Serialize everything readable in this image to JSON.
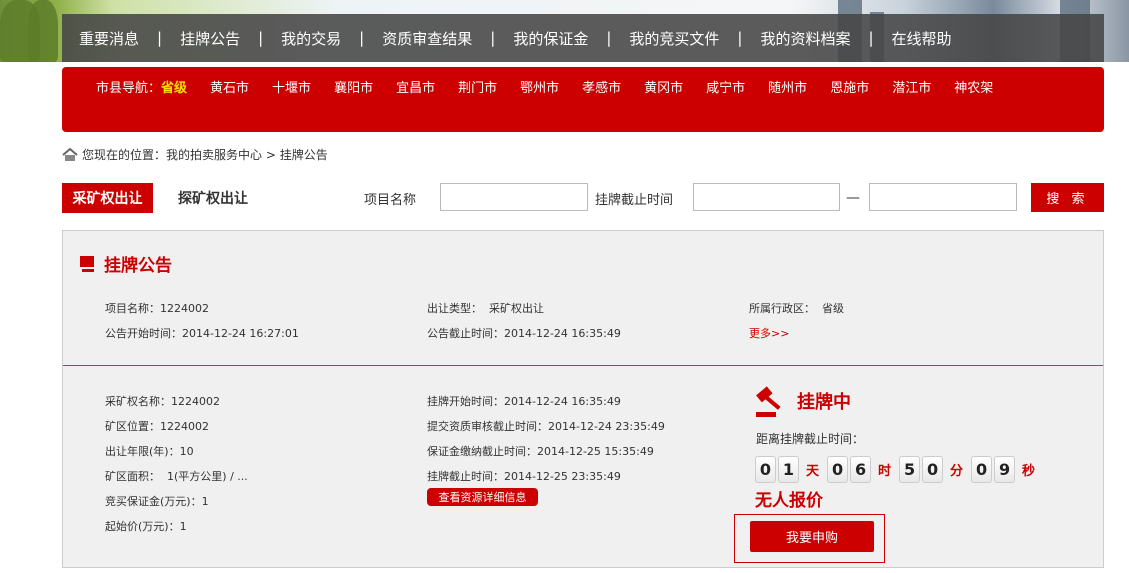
{
  "top_nav": [
    "重要消息",
    "挂牌公告",
    "我的交易",
    "资质审查结果",
    "我的保证金",
    "我的竞买文件",
    "我的资料档案",
    "在线帮助"
  ],
  "top_nav_separator": "|",
  "city_nav": {
    "label": "市县导航：",
    "province": "省级",
    "cities": [
      "黄石市",
      "十堰市",
      "襄阳市",
      "宜昌市",
      "荆门市",
      "鄂州市",
      "孝感市",
      "黄冈市",
      "咸宁市",
      "随州市",
      "恩施市",
      "潜江市",
      "神农架"
    ]
  },
  "breadcrumb": {
    "prefix": "您现在的位置：",
    "link": "我的拍卖服务中心",
    "arrow": " > ",
    "current": "挂牌公告"
  },
  "filter": {
    "tab_active": "采矿权出让",
    "tab_other": "探矿权出让",
    "project_label": "项目名称",
    "deadline_label": "挂牌截止时间",
    "dash": "—",
    "search_button": "搜 索",
    "project_value": "",
    "date_from": "",
    "date_to": ""
  },
  "section_title": "挂牌公告",
  "summary": {
    "project_name": "项目名称：1224002",
    "transfer_type": "出让类型：  采矿权出让",
    "region": "所属行政区：  省级",
    "announce_start": "公告开始时间：2014-12-24 16:27:01",
    "announce_end": "公告截止时间：2014-12-24 16:35:49",
    "more": "更多>>"
  },
  "details": {
    "left": [
      "采矿权名称：1224002",
      "矿区位置：1224002",
      "出让年限(年)：10",
      "矿区面积：  1(平方公里) / ...",
      "竞买保证金(万元)：1",
      "起始价(万元)：1"
    ],
    "middle": [
      "挂牌开始时间：2014-12-24 16:35:49",
      "提交资质审核截止时间：2014-12-24 23:35:49",
      "保证金缴纳截止时间：2014-12-25 15:35:49",
      "挂牌截止时间：2014-12-25 23:35:49"
    ],
    "detail_button": "查看资源详细信息"
  },
  "status": {
    "label": "挂牌中",
    "countdown_label": "距离挂牌截止时间：",
    "days": [
      "0",
      "1"
    ],
    "hours": [
      "0",
      "6"
    ],
    "minutes": [
      "5",
      "0"
    ],
    "seconds": [
      "0",
      "9"
    ],
    "unit_day": "天",
    "unit_hour": "时",
    "unit_min": "分",
    "unit_sec": "秒",
    "no_quote": "无人报价",
    "buy_button": "我要申购"
  },
  "colors": {
    "accent": "#cc0000",
    "province": "#ffde00"
  }
}
